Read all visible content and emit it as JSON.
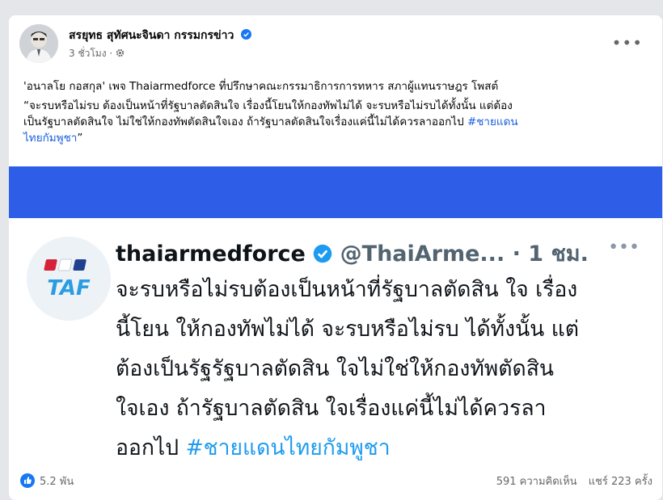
{
  "post": {
    "author": "สรยุทธ สุทัศนะจินดา กรรมกรข่าว",
    "time": "3 ชั่วโมง",
    "line1": "'อนาลโย กอสกุล' เพจ Thaiarmedforce ที่ปรึกษาคณะกรรมาธิการการทหาร สภาผู้แทนราษฎร โพสต์",
    "line2": "“จะรบหรือไม่รบ ต้องเป็นหน้าที่รัฐบาลตัดสินใจ เรื่องนี้โยนให้กองทัพไม่ได้ จะรบหรือไม่รบได้ทั้งนั้น แต่ต้อง",
    "line3": "เป็นรัฐบาลตัดสินใจ ไม่ใช่ให้กองทัพตัดสินใจเอง ถ้ารัฐบาลตัดสินใจเรื่องแค่นี้ไม่ได้ควรลาออกไป ",
    "hashtag_part1": "#ชายแดน",
    "hashtag_part2": "ไทยกัมพูชา",
    "line4_end": "”"
  },
  "tweet": {
    "name": "thaiarmedforce",
    "handle": "@ThaiArme...",
    "time": "· 1 ชม.",
    "logo_text": "TAF",
    "text_lines": [
      "จะรบหรือไม่รบต้องเป็นหน้าที่รัฐบาลตัดสิน ใจ เรื่อง",
      "นี้โยน ให้กองทัพไม่ได้ จะรบหรือไม่รบ ได้ทั้งนั้น แต่",
      "ต้องเป็นรัฐรัฐบาลตัดสิน ใจไม่ใช่ให้กองทัพตัดสิน",
      "ใจเอง ถ้ารัฐบาลตัดสิน ใจเรื่องแค่นี้ไม่ได้ควรลา"
    ],
    "last_line_prefix": "ออกไป ",
    "last_line_hashtag": "#ชายแดนไทยกัมพูชา"
  },
  "footer": {
    "likes": "5.2 พัน",
    "comments": "591 ความคิดเห็น",
    "shares": "แชร์ 223 ครั้ง"
  },
  "colors": {
    "accent": "#1877f2",
    "hashtag": "#1a5fe0",
    "banner": "#2e5ee8"
  }
}
